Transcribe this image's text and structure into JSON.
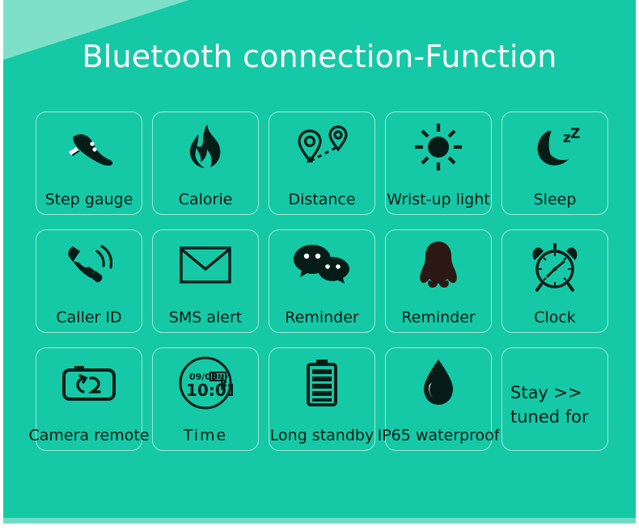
{
  "page": {
    "title": "Bluetooth connection-Function",
    "background_color": "#15c9a6",
    "accent_color": "#7fe0ca",
    "tile_border_color": "#9fe9d9",
    "title_color": "#ffffff",
    "icon_color": "#061c16"
  },
  "grid": {
    "rows": [
      {
        "tiles": [
          {
            "label": "Step gauge",
            "icon": "shoe-icon"
          },
          {
            "label": "Calorie",
            "icon": "flame-icon"
          },
          {
            "label": "Distance",
            "icon": "map-pin-route-icon"
          },
          {
            "label": "Wrist-up light",
            "icon": "sun-icon"
          },
          {
            "label": "Sleep",
            "icon": "moon-zz-icon"
          }
        ]
      },
      {
        "tiles": [
          {
            "label": "Caller ID",
            "icon": "ringing-phone-icon"
          },
          {
            "label": "SMS alert",
            "icon": "envelope-icon"
          },
          {
            "label": "Reminder",
            "icon": "wechat-bubbles-icon"
          },
          {
            "label": "Reminder",
            "icon": "qq-penguin-icon"
          },
          {
            "label": "Clock",
            "icon": "alarm-clock-icon"
          }
        ]
      },
      {
        "tiles": [
          {
            "label": "Camera remote",
            "icon": "camera-icon"
          },
          {
            "label": "Time",
            "icon": "watch-face-icon"
          },
          {
            "label": "Long standby",
            "icon": "battery-icon"
          },
          {
            "label": "IP65  waterproof",
            "icon": "water-drop-icon"
          },
          {
            "label": "",
            "icon": "none",
            "text_lines": [
              "Stay >>",
              "tuned for"
            ]
          }
        ]
      }
    ]
  },
  "watch_face": {
    "date": "09/05",
    "time": "10:01",
    "bluetooth_glyph": "bluetooth-icon",
    "battery_glyph": "battery-icon"
  },
  "sleep_icon": {
    "zz_text": "zZ"
  }
}
